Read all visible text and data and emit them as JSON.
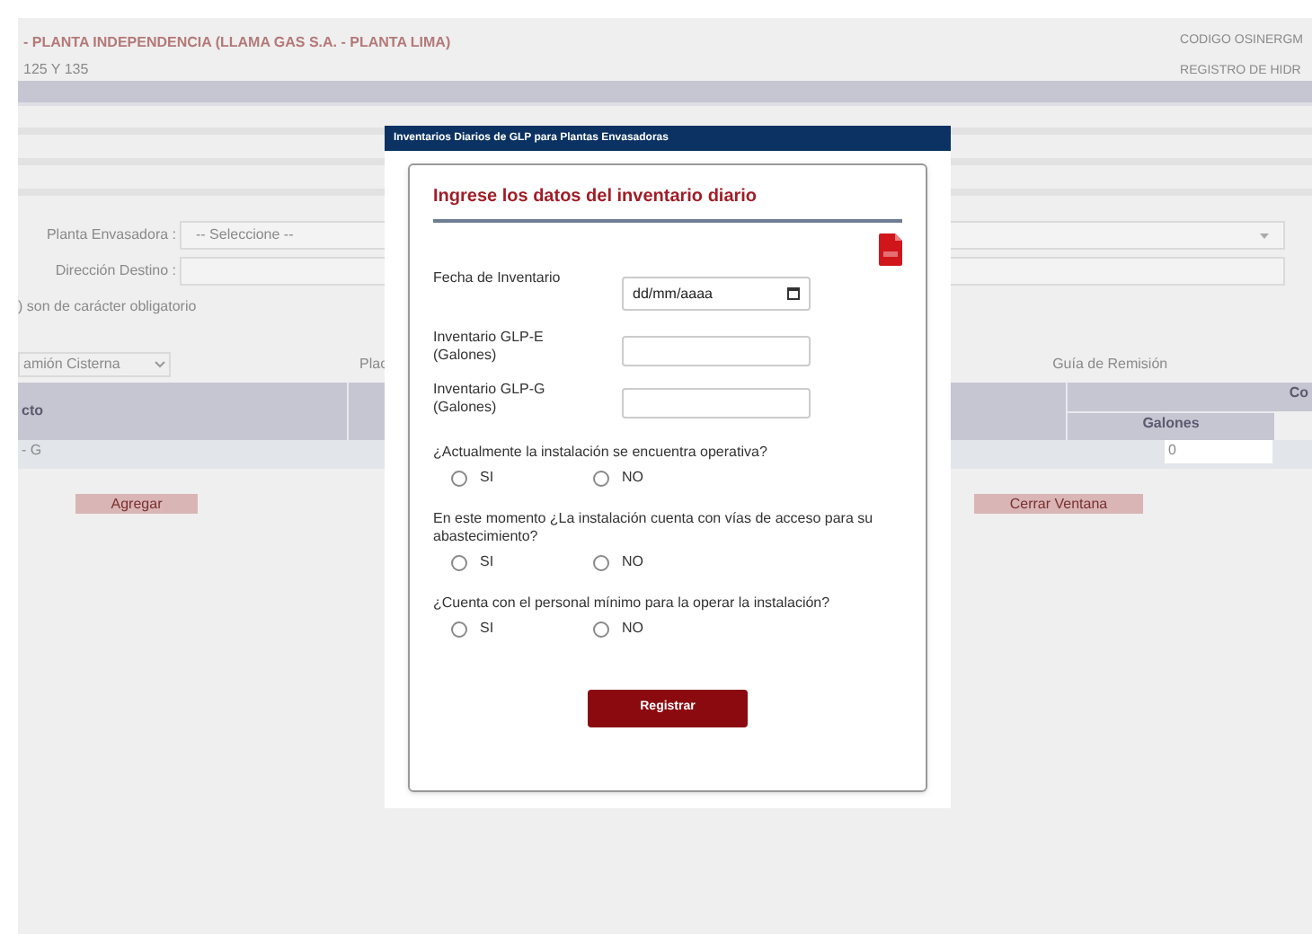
{
  "background_page": {
    "title": "- PLANTA INDEPENDENCIA (LLAMA GAS S.A. - PLANTA LIMA)",
    "subtitle": "125 Y 135",
    "code_label": "CODIGO OSINERGM",
    "registry_label": "REGISTRO DE HIDR",
    "fields": [
      {
        "label": "Planta Envasadora :",
        "value": "-- Seleccione --",
        "kind": "select"
      },
      {
        "label": "Dirección Destino :",
        "kind": "text"
      }
    ],
    "required_note": ") son de carácter obligatorio",
    "vehicle_select": "amión Cisterna",
    "plate_label": "Plac",
    "guide_label": "Guía de Remisión",
    "table": {
      "column_1": "cto",
      "column_3": "Co",
      "column_3_sub": "Galones",
      "rows": [
        {
          "column_1": "- G",
          "column_3": "0"
        }
      ]
    },
    "buttons": [
      "Agregar",
      "Cerrar Ventana"
    ]
  },
  "dialog": {
    "title": "Inventarios Diarios de GLP para Plantas Envasadoras",
    "heading": "Ingrese los datos del inventario diario",
    "fields": [
      {
        "label": "Fecha de Inventario",
        "placeholder": "dd/mm/aaaa",
        "kind": "date"
      },
      {
        "label": "Inventario GLP-E (Galones)",
        "kind": "number"
      },
      {
        "label": "Inventario GLP-G (Galones)",
        "kind": "number"
      }
    ],
    "questions": [
      {
        "text": "¿Actualmente la instalación se encuentra operativa?",
        "options": [
          {
            "label": "SI",
            "selected": false
          },
          {
            "label": "NO",
            "selected": false
          }
        ]
      },
      {
        "text": "En este momento ¿La instalación cuenta con vías de acceso para su abastecimiento?",
        "options": [
          {
            "label": "SI",
            "selected": false
          },
          {
            "label": "NO",
            "selected": false
          }
        ]
      },
      {
        "text": "¿Cuenta con el personal mínimo para la operar la instalación?",
        "options": [
          {
            "label": "SI",
            "selected": false
          },
          {
            "label": "NO",
            "selected": false
          }
        ]
      }
    ],
    "submit": "Registrar"
  }
}
